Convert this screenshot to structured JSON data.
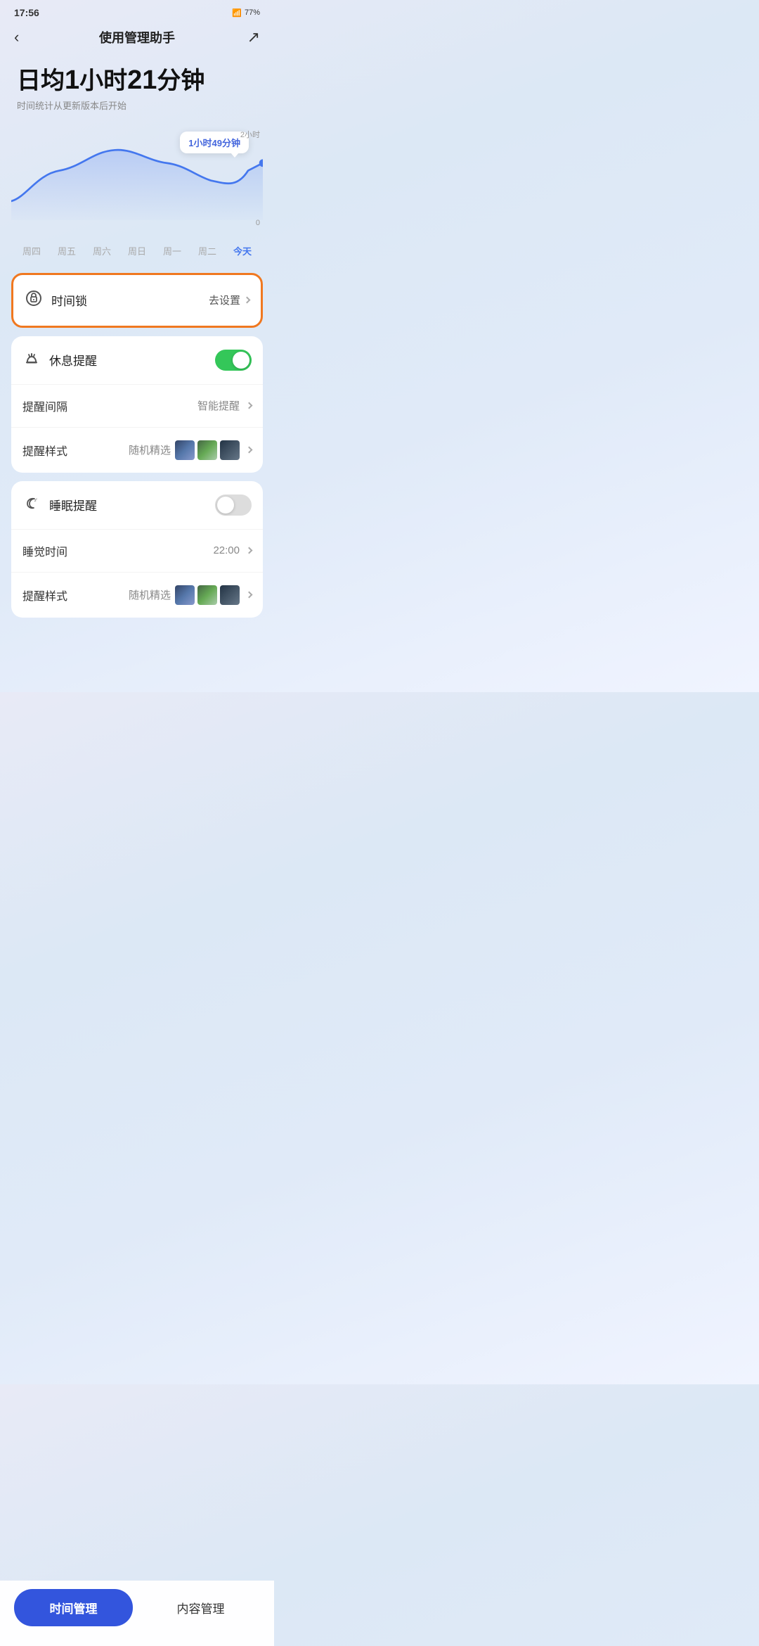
{
  "status": {
    "time": "17:56",
    "battery": "77%",
    "icons": "🔋"
  },
  "nav": {
    "back_icon": "‹",
    "title": "使用管理助手",
    "share_icon": "↗"
  },
  "daily": {
    "line1": "日均",
    "num1": "1",
    "unit1": "小时",
    "num2": "21",
    "unit2": "分钟",
    "subtitle": "时间统计从更新版本后开始"
  },
  "chart": {
    "tooltip": "1小时49分钟",
    "y_top": "2小时",
    "y_zero": "0",
    "x_labels": [
      "周四",
      "周五",
      "周六",
      "周日",
      "周一",
      "周二",
      "今天"
    ]
  },
  "time_lock": {
    "icon": "⏰",
    "label": "时间锁",
    "action": "去设置",
    "chevron": ">"
  },
  "rest_reminder": {
    "icon": "☕",
    "label": "休息提醒",
    "toggle_on": true,
    "interval_label": "提醒间隔",
    "interval_value": "智能提醒",
    "style_label": "提醒样式",
    "style_value": "随机精选"
  },
  "sleep_reminder": {
    "icon": "🌙",
    "label": "睡眠提醒",
    "toggle_on": false,
    "sleep_time_label": "睡觉时间",
    "sleep_time_value": "22:00",
    "style_label": "提醒样式",
    "style_value": "随机精选"
  },
  "bottom_tabs": {
    "active": "时间管理",
    "inactive": "内容管理"
  }
}
